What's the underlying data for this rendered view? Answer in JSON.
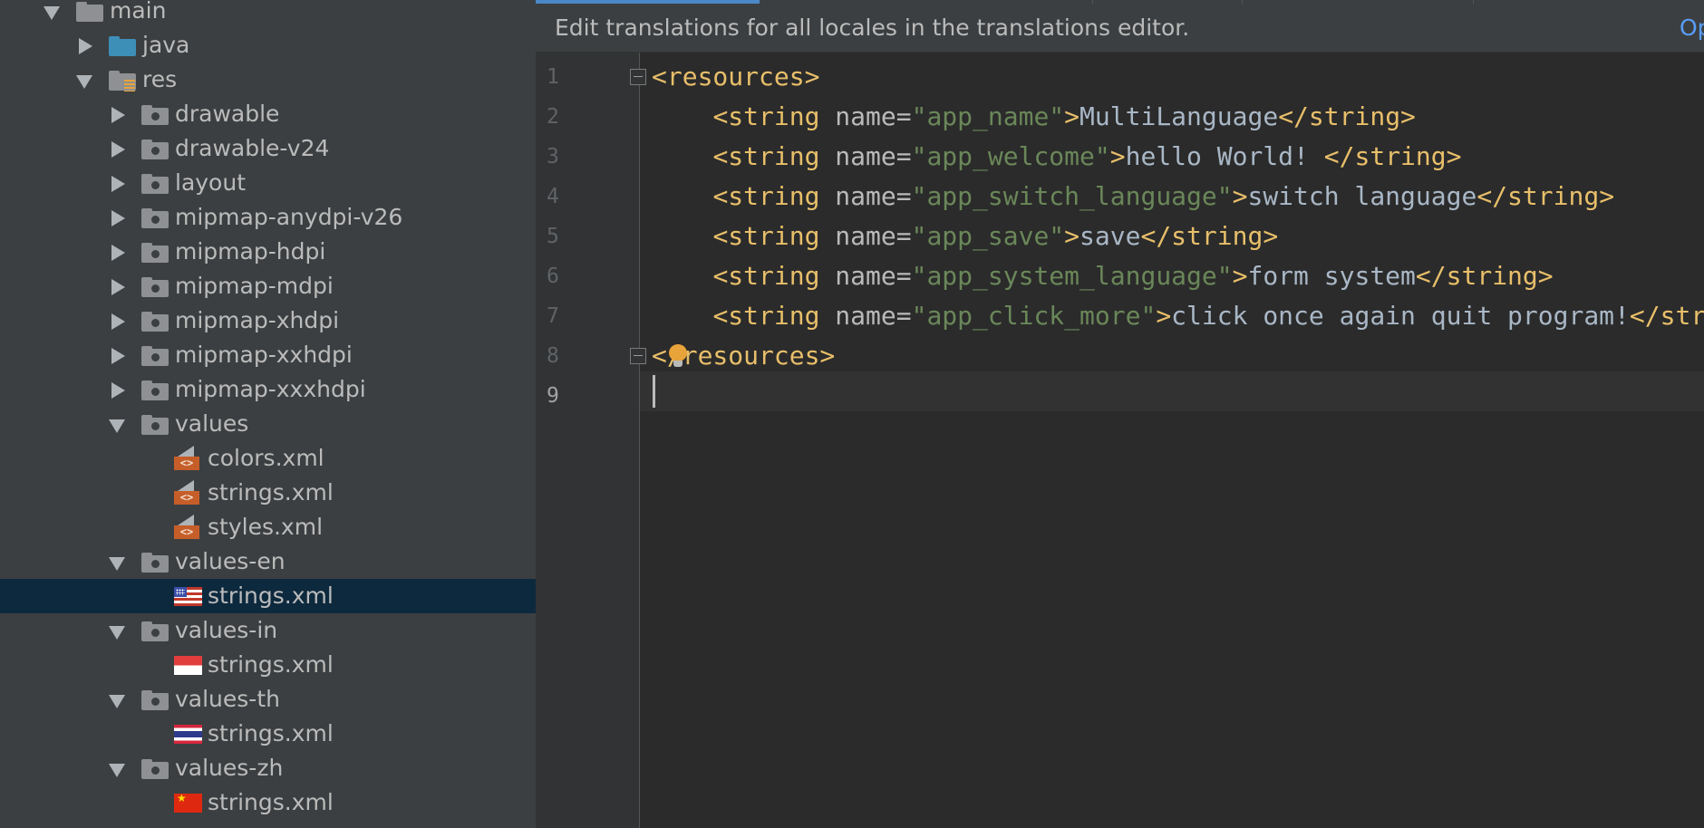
{
  "tree": [
    {
      "depth": 0,
      "arrow": "expanded",
      "icon": "folder",
      "label": "main"
    },
    {
      "depth": 1,
      "arrow": "collapsed",
      "icon": "java-folder",
      "label": "java"
    },
    {
      "depth": 1,
      "arrow": "expanded",
      "icon": "res-folder",
      "label": "res"
    },
    {
      "depth": 2,
      "arrow": "collapsed",
      "icon": "resource-folder",
      "label": "drawable"
    },
    {
      "depth": 2,
      "arrow": "collapsed",
      "icon": "resource-folder",
      "label": "drawable-v24"
    },
    {
      "depth": 2,
      "arrow": "collapsed",
      "icon": "resource-folder",
      "label": "layout"
    },
    {
      "depth": 2,
      "arrow": "collapsed",
      "icon": "resource-folder",
      "label": "mipmap-anydpi-v26"
    },
    {
      "depth": 2,
      "arrow": "collapsed",
      "icon": "resource-folder",
      "label": "mipmap-hdpi"
    },
    {
      "depth": 2,
      "arrow": "collapsed",
      "icon": "resource-folder",
      "label": "mipmap-mdpi"
    },
    {
      "depth": 2,
      "arrow": "collapsed",
      "icon": "resource-folder",
      "label": "mipmap-xhdpi"
    },
    {
      "depth": 2,
      "arrow": "collapsed",
      "icon": "resource-folder",
      "label": "mipmap-xxhdpi"
    },
    {
      "depth": 2,
      "arrow": "collapsed",
      "icon": "resource-folder",
      "label": "mipmap-xxxhdpi"
    },
    {
      "depth": 2,
      "arrow": "expanded",
      "icon": "resource-folder",
      "label": "values"
    },
    {
      "depth": 3,
      "arrow": "none",
      "icon": "xml-file",
      "label": "colors.xml"
    },
    {
      "depth": 3,
      "arrow": "none",
      "icon": "xml-file",
      "label": "strings.xml"
    },
    {
      "depth": 3,
      "arrow": "none",
      "icon": "xml-file",
      "label": "styles.xml"
    },
    {
      "depth": 2,
      "arrow": "expanded",
      "icon": "resource-folder",
      "label": "values-en"
    },
    {
      "depth": 3,
      "arrow": "none",
      "icon": "flag-us",
      "label": "strings.xml",
      "selected": true
    },
    {
      "depth": 2,
      "arrow": "expanded",
      "icon": "resource-folder",
      "label": "values-in"
    },
    {
      "depth": 3,
      "arrow": "none",
      "icon": "flag-id",
      "label": "strings.xml"
    },
    {
      "depth": 2,
      "arrow": "expanded",
      "icon": "resource-folder",
      "label": "values-th"
    },
    {
      "depth": 3,
      "arrow": "none",
      "icon": "flag-th",
      "label": "strings.xml"
    },
    {
      "depth": 2,
      "arrow": "expanded",
      "icon": "resource-folder",
      "label": "values-zh"
    },
    {
      "depth": 3,
      "arrow": "none",
      "icon": "flag-cn",
      "label": "strings.xml"
    }
  ],
  "notification": {
    "message": "Edit translations for all locales in the translations editor.",
    "link": "Op"
  },
  "editor": {
    "current_line": 9,
    "lines": [
      {
        "number": "1",
        "tokens": [
          {
            "t": "tag",
            "v": "<resources>"
          }
        ]
      },
      {
        "number": "2",
        "tokens": [
          {
            "t": "txt",
            "v": "    "
          },
          {
            "t": "tag",
            "v": "<string "
          },
          {
            "t": "attr",
            "v": "name="
          },
          {
            "t": "val",
            "v": "\"app_name\""
          },
          {
            "t": "tag",
            "v": ">"
          },
          {
            "t": "txt",
            "v": "MultiLanguage"
          },
          {
            "t": "tag",
            "v": "</string>"
          }
        ]
      },
      {
        "number": "3",
        "tokens": [
          {
            "t": "txt",
            "v": "    "
          },
          {
            "t": "tag",
            "v": "<string "
          },
          {
            "t": "attr",
            "v": "name="
          },
          {
            "t": "val",
            "v": "\"app_welcome\""
          },
          {
            "t": "tag",
            "v": ">"
          },
          {
            "t": "txt",
            "v": "hello World! "
          },
          {
            "t": "tag",
            "v": "</string>"
          }
        ]
      },
      {
        "number": "4",
        "tokens": [
          {
            "t": "txt",
            "v": "    "
          },
          {
            "t": "tag",
            "v": "<string "
          },
          {
            "t": "attr",
            "v": "name="
          },
          {
            "t": "val",
            "v": "\"app_switch_language\""
          },
          {
            "t": "tag",
            "v": ">"
          },
          {
            "t": "txt",
            "v": "switch language"
          },
          {
            "t": "tag",
            "v": "</string>"
          }
        ]
      },
      {
        "number": "5",
        "tokens": [
          {
            "t": "txt",
            "v": "    "
          },
          {
            "t": "tag",
            "v": "<string "
          },
          {
            "t": "attr",
            "v": "name="
          },
          {
            "t": "val",
            "v": "\"app_save\""
          },
          {
            "t": "tag",
            "v": ">"
          },
          {
            "t": "txt",
            "v": "save"
          },
          {
            "t": "tag",
            "v": "</string>"
          }
        ]
      },
      {
        "number": "6",
        "tokens": [
          {
            "t": "txt",
            "v": "    "
          },
          {
            "t": "tag",
            "v": "<string "
          },
          {
            "t": "attr",
            "v": "name="
          },
          {
            "t": "val",
            "v": "\"app_system_language\""
          },
          {
            "t": "tag",
            "v": ">"
          },
          {
            "t": "txt",
            "v": "form system"
          },
          {
            "t": "tag",
            "v": "</string>"
          }
        ]
      },
      {
        "number": "7",
        "tokens": [
          {
            "t": "txt",
            "v": "    "
          },
          {
            "t": "tag",
            "v": "<string "
          },
          {
            "t": "attr",
            "v": "name="
          },
          {
            "t": "val",
            "v": "\"app_click_more\""
          },
          {
            "t": "tag",
            "v": ">"
          },
          {
            "t": "txt",
            "v": "click once again quit program!"
          },
          {
            "t": "tag",
            "v": "</string>"
          }
        ]
      },
      {
        "number": "8",
        "tokens": [
          {
            "t": "tag",
            "v": "</resources>"
          }
        ]
      },
      {
        "number": "9",
        "tokens": []
      }
    ]
  },
  "colors": {
    "sidebar_bg": "#3c3f41",
    "editor_bg": "#2b2b2b",
    "selection": "#0d293e",
    "tag": "#e8bf6a",
    "attr_value": "#6a8759",
    "link": "#589df6"
  }
}
